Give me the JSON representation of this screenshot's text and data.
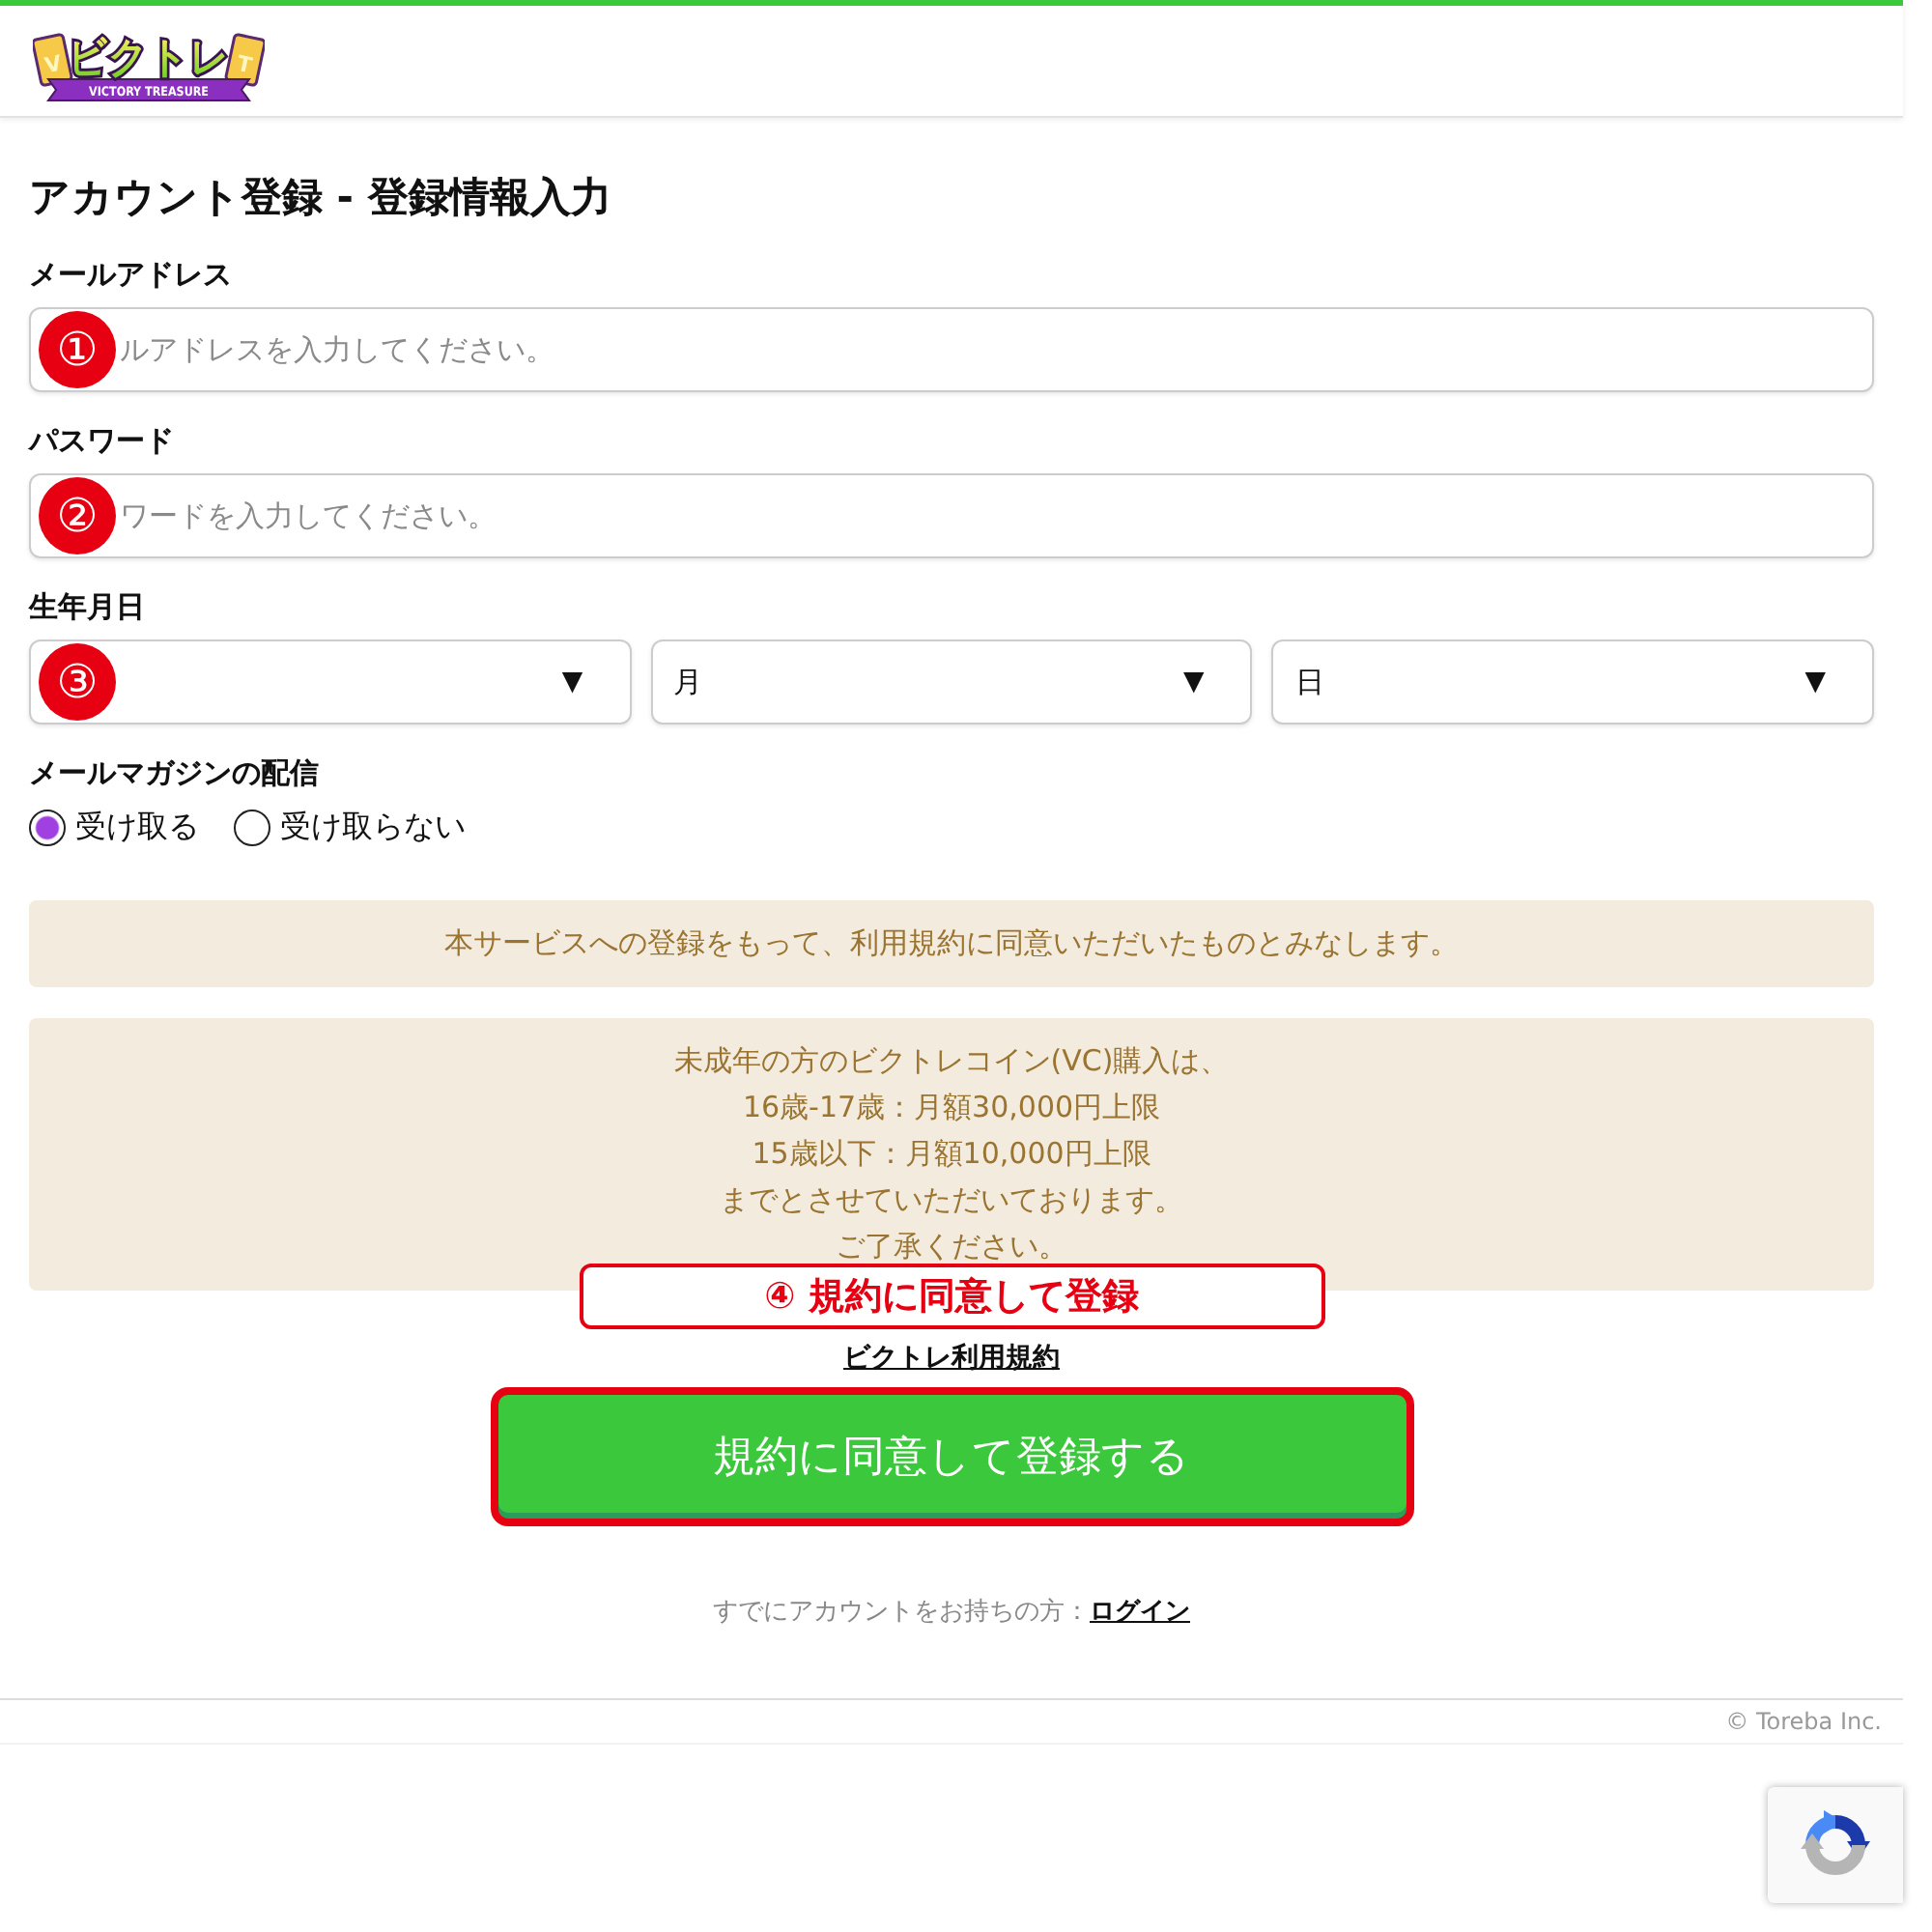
{
  "header": {
    "logo": {
      "title": "ビクトレ",
      "subtitle": "VICTORY TREASURE",
      "left_card": "V",
      "right_card": "T"
    }
  },
  "page_title": "アカウント登録 - 登録情報入力",
  "fields": [
    {
      "kind": "input",
      "label": "メールアドレス",
      "placeholder": "ルアドレスを入力してください。",
      "marker": "①"
    },
    {
      "kind": "input",
      "label": "パスワード",
      "placeholder": "ワードを入力してください。",
      "marker": "②"
    },
    {
      "kind": "date",
      "label": "生年月日",
      "selects": [
        {
          "caret": "▼",
          "marker": "③"
        },
        {
          "value": "月",
          "caret": "▼"
        },
        {
          "value": "日",
          "caret": "▼"
        }
      ]
    }
  ],
  "newsletter": {
    "label": "メールマガジンの配信",
    "options": [
      {
        "label": "受け取る",
        "selected": true
      },
      {
        "label": "受け取らない",
        "selected": false
      }
    ]
  },
  "notices": [
    {
      "lines": [
        "本サービスへの登録をもって、利用規約に同意いただいたものとみなします。"
      ]
    },
    {
      "lines": [
        "未成年の方のビクトレコイン(VC)購入は、",
        "16歳-17歳：月額30,000円上限",
        "15歳以下：月額10,000円上限",
        "までとさせていただいております。",
        "ご了承ください。"
      ]
    }
  ],
  "callout": "④ 規約に同意して登録",
  "terms_link": "ビクトレ利用規約",
  "submit_button": {
    "label": "規約に同意して登録する",
    "highlighted": true
  },
  "login_prompt": {
    "text": "すでにアカウントをお持ちの方：",
    "link": "ログイン"
  },
  "footer": {
    "copyright": "© Toreba Inc."
  }
}
